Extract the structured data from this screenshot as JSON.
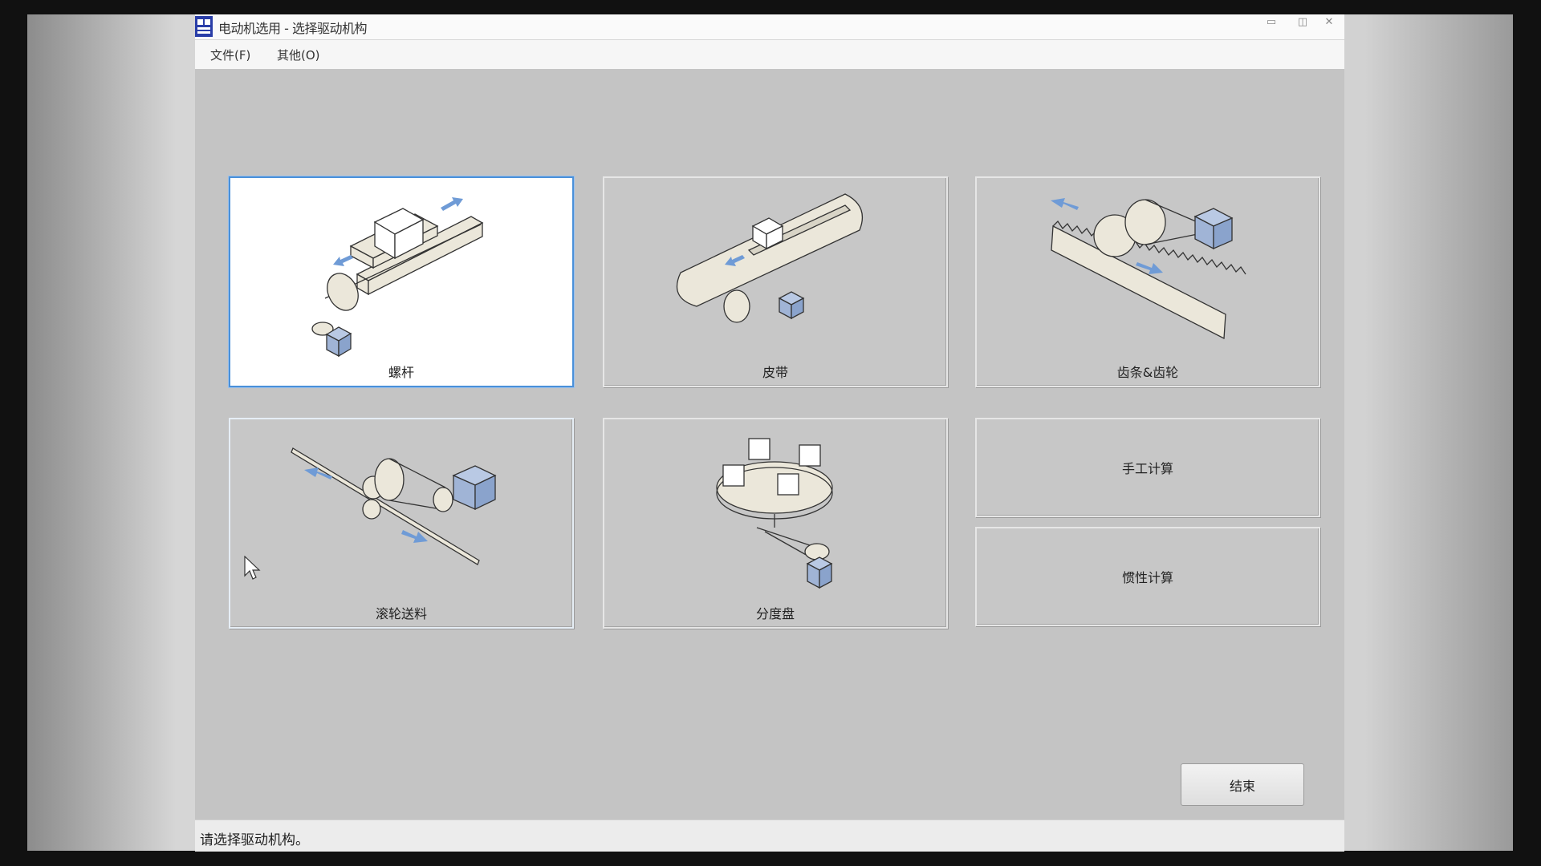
{
  "window": {
    "title": "电动机选用 - 选择驱动机构",
    "controls": {
      "minimize": "▭",
      "maximize": "◫",
      "close": "✕"
    }
  },
  "menu": [
    {
      "label": "文件(F)"
    },
    {
      "label": "其他(O)"
    }
  ],
  "mechanisms": [
    {
      "label": "螺杆",
      "icon": "ball-screw-icon",
      "selected": true
    },
    {
      "label": "皮带",
      "icon": "belt-conveyor-icon",
      "selected": false
    },
    {
      "label": "齿条&齿轮",
      "icon": "rack-pinion-icon",
      "selected": false
    },
    {
      "label": "滚轮送料",
      "icon": "roller-feed-icon",
      "selected": false
    },
    {
      "label": "分度盘",
      "icon": "index-table-icon",
      "selected": false
    }
  ],
  "calc_buttons": [
    {
      "label": "手工计算"
    },
    {
      "label": "惯性计算"
    }
  ],
  "end_button": {
    "label": "结束"
  },
  "status": {
    "text": "请选择驱动机构。"
  },
  "colors": {
    "accent": "#4a90d9",
    "arrow": "#6f9bd6",
    "panel": "#c4c4c4"
  }
}
